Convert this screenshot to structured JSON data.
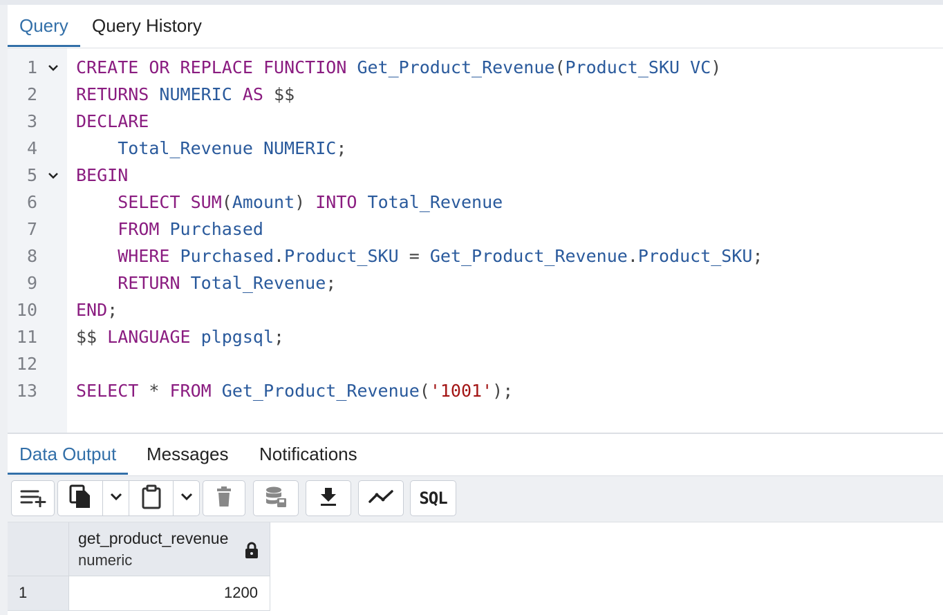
{
  "query_tabs": [
    {
      "label": "Query",
      "active": true
    },
    {
      "label": "Query History",
      "active": false
    }
  ],
  "editor": {
    "lines": [
      {
        "num": "1",
        "fold": true,
        "tokens": [
          {
            "t": "CREATE",
            "c": "kw"
          },
          {
            "t": " "
          },
          {
            "t": "OR",
            "c": "kw"
          },
          {
            "t": " "
          },
          {
            "t": "REPLACE",
            "c": "kw"
          },
          {
            "t": " "
          },
          {
            "t": "FUNCTION",
            "c": "kw"
          },
          {
            "t": " "
          },
          {
            "t": "Get_Product_Revenue",
            "c": "id"
          },
          {
            "t": "(",
            "c": "pn"
          },
          {
            "t": "Product_SKU",
            "c": "id"
          },
          {
            "t": " "
          },
          {
            "t": "VC",
            "c": "id"
          },
          {
            "t": ")",
            "c": "pn"
          }
        ]
      },
      {
        "num": "2",
        "fold": false,
        "tokens": [
          {
            "t": "RETURNS",
            "c": "kw"
          },
          {
            "t": " "
          },
          {
            "t": "NUMERIC",
            "c": "id"
          },
          {
            "t": " "
          },
          {
            "t": "AS",
            "c": "kw"
          },
          {
            "t": " "
          },
          {
            "t": "$$",
            "c": "pn"
          }
        ]
      },
      {
        "num": "3",
        "fold": false,
        "tokens": [
          {
            "t": "DECLARE",
            "c": "kw"
          }
        ]
      },
      {
        "num": "4",
        "fold": false,
        "tokens": [
          {
            "t": "    "
          },
          {
            "t": "Total_Revenue",
            "c": "id"
          },
          {
            "t": " "
          },
          {
            "t": "NUMERIC",
            "c": "id"
          },
          {
            "t": ";",
            "c": "pn"
          }
        ]
      },
      {
        "num": "5",
        "fold": true,
        "tokens": [
          {
            "t": "BEGIN",
            "c": "kw"
          }
        ]
      },
      {
        "num": "6",
        "fold": false,
        "tokens": [
          {
            "t": "    "
          },
          {
            "t": "SELECT",
            "c": "kw"
          },
          {
            "t": " "
          },
          {
            "t": "SUM",
            "c": "kw"
          },
          {
            "t": "(",
            "c": "pn"
          },
          {
            "t": "Amount",
            "c": "id"
          },
          {
            "t": ")",
            "c": "pn"
          },
          {
            "t": " "
          },
          {
            "t": "INTO",
            "c": "kw"
          },
          {
            "t": " "
          },
          {
            "t": "Total_Revenue",
            "c": "id"
          }
        ]
      },
      {
        "num": "7",
        "fold": false,
        "tokens": [
          {
            "t": "    "
          },
          {
            "t": "FROM",
            "c": "kw"
          },
          {
            "t": " "
          },
          {
            "t": "Purchased",
            "c": "id"
          }
        ]
      },
      {
        "num": "8",
        "fold": false,
        "tokens": [
          {
            "t": "    "
          },
          {
            "t": "WHERE",
            "c": "kw"
          },
          {
            "t": " "
          },
          {
            "t": "Purchased",
            "c": "id"
          },
          {
            "t": ".",
            "c": "pn"
          },
          {
            "t": "Product_SKU",
            "c": "id"
          },
          {
            "t": " "
          },
          {
            "t": "=",
            "c": "pn"
          },
          {
            "t": " "
          },
          {
            "t": "Get_Product_Revenue",
            "c": "id"
          },
          {
            "t": ".",
            "c": "pn"
          },
          {
            "t": "Product_SKU",
            "c": "id"
          },
          {
            "t": ";",
            "c": "pn"
          }
        ]
      },
      {
        "num": "9",
        "fold": false,
        "tokens": [
          {
            "t": "    "
          },
          {
            "t": "RETURN",
            "c": "kw"
          },
          {
            "t": " "
          },
          {
            "t": "Total_Revenue",
            "c": "id"
          },
          {
            "t": ";",
            "c": "pn"
          }
        ]
      },
      {
        "num": "10",
        "fold": false,
        "tokens": [
          {
            "t": "END",
            "c": "kw"
          },
          {
            "t": ";",
            "c": "pn"
          }
        ]
      },
      {
        "num": "11",
        "fold": false,
        "tokens": [
          {
            "t": "$$",
            "c": "pn"
          },
          {
            "t": " "
          },
          {
            "t": "LANGUAGE",
            "c": "kw"
          },
          {
            "t": " "
          },
          {
            "t": "plpgsql",
            "c": "id"
          },
          {
            "t": ";",
            "c": "pn"
          }
        ]
      },
      {
        "num": "12",
        "fold": false,
        "tokens": []
      },
      {
        "num": "13",
        "fold": false,
        "tokens": [
          {
            "t": "SELECT",
            "c": "kw"
          },
          {
            "t": " "
          },
          {
            "t": "*",
            "c": "pn"
          },
          {
            "t": " "
          },
          {
            "t": "FROM",
            "c": "kw"
          },
          {
            "t": " "
          },
          {
            "t": "Get_Product_Revenue",
            "c": "id"
          },
          {
            "t": "(",
            "c": "pn"
          },
          {
            "t": "'1001'",
            "c": "str"
          },
          {
            "t": ")",
            "c": "pn"
          },
          {
            "t": ";",
            "c": "pn"
          }
        ]
      }
    ]
  },
  "output_tabs": [
    {
      "label": "Data Output",
      "active": true
    },
    {
      "label": "Messages",
      "active": false
    },
    {
      "label": "Notifications",
      "active": false
    }
  ],
  "toolbar": {
    "sql_label": "SQL",
    "icons": [
      "add-row-icon",
      "copy-icon",
      "chevron-down-icon",
      "paste-icon",
      "chevron-down-icon",
      "delete-icon",
      "save-data-icon",
      "download-icon",
      "graph-icon",
      "sql-icon"
    ]
  },
  "grid": {
    "columns": [
      {
        "name": "get_product_revenue",
        "type": "numeric",
        "icon": "lock-icon"
      }
    ],
    "rows": [
      {
        "num": "1",
        "values": [
          "1200"
        ]
      }
    ]
  },
  "colors": {
    "accent": "#326fa8",
    "keyword": "#8a1c80",
    "identifier": "#2a5a9c",
    "string": "#a31515"
  }
}
